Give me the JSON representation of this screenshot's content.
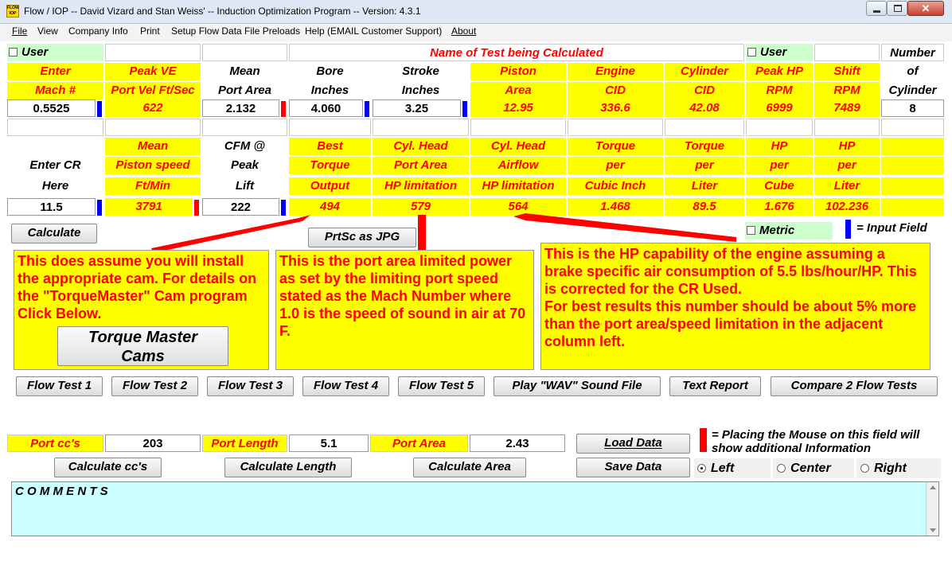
{
  "window": {
    "title": "Flow / IOP -- David Vizard and Stan Weiss' -- Induction Optimization Program -- Version: 4.3.1",
    "app_icon_label": "FLOW IOP"
  },
  "menu": [
    "File",
    "View",
    "Company Info",
    "Print",
    "Setup Flow Data File Preloads",
    "Help (EMAIL Customer Support)",
    "About"
  ],
  "grid": {
    "user_left": "User",
    "test_name_label": "Name of Test being Calculated",
    "user_right": "User",
    "number_label": "Number",
    "row1": [
      "Enter",
      "Peak VE",
      "Mean",
      "Bore",
      "Stroke",
      "Piston",
      "Engine",
      "Cylinder",
      "Peak HP",
      "Shift",
      "of"
    ],
    "row2": [
      "Mach #",
      "Port Vel Ft/Sec",
      "Port Area",
      "Inches",
      "Inches",
      "Area",
      "CID",
      "CID",
      "RPM",
      "RPM",
      "Cylinder"
    ],
    "row3": [
      "0.5525",
      "622",
      "2.132",
      "4.060",
      "3.25",
      "12.95",
      "336.6",
      "42.08",
      "6999",
      "7489",
      "8"
    ],
    "row5": [
      "",
      "Mean",
      "CFM @",
      "Best",
      "Cyl. Head",
      "Cyl. Head",
      "Torque",
      "Torque",
      "HP",
      "HP"
    ],
    "row6": [
      "Enter CR",
      "Piston speed",
      "Peak",
      "Torque",
      "Port Area",
      "Airflow",
      "per",
      "per",
      "per",
      "per"
    ],
    "row7": [
      "Here",
      "Ft/Min",
      "Lift",
      "Output",
      "HP limitation",
      "HP limitation",
      "Cubic Inch",
      "Liter",
      "Cube",
      "Liter"
    ],
    "row8": [
      "11.5",
      "3791",
      "222",
      "494",
      "579",
      "564",
      "1.468",
      "89.5",
      "1.676",
      "102.236"
    ]
  },
  "buttons": {
    "calculate": "Calculate",
    "prtsc": "PrtSc as JPG",
    "torque_master": "Torque Master Cams",
    "flow_tests": [
      "Flow Test 1",
      "Flow Test 2",
      "Flow Test 3",
      "Flow Test 4",
      "Flow Test 5"
    ],
    "play_wav": "Play \"WAV\" Sound File",
    "text_report": "Text Report",
    "compare": "Compare 2 Flow Tests",
    "load": "Load Data",
    "save": "Save Data",
    "calc_cc": "Calculate cc's",
    "calc_length": "Calculate Length",
    "calc_area": "Calculate Area"
  },
  "metric_label": "Metric",
  "input_field_legend": "= Input Field",
  "notes": {
    "cam": "This does assume you will install the appropriate cam. For details on the \"TorqueMaster\" Cam program Click Below.",
    "port": "This is the port area limited power as set by the limiting port speed stated as the Mach Number where 1.0 is the speed of sound in air at 70 F.",
    "hp": "This is the HP capability of the engine assuming a brake specific air consumption of 5.5 lbs/hour/HP. This is corrected for the CR Used.\nFor best results this number should be about 5% more than the port area/speed limitation in the adjacent column left."
  },
  "port_calc": {
    "cc_label": "Port cc's",
    "cc_value": "203",
    "length_label": "Port Length",
    "length_value": "5.1",
    "area_label": "Port Area",
    "area_value": "2.43"
  },
  "mouse_legend": "= Placing the Mouse on this field will show additional Information",
  "align": {
    "options": [
      "Left",
      "Center",
      "Right"
    ],
    "selected": "Left"
  },
  "comments_label": "C O M M E N T S",
  "colors": {
    "yellow": "#ffff00",
    "red": "#ff0000",
    "blue": "#0000ff",
    "green": "#ccffcc",
    "cyan": "#ccffff"
  }
}
